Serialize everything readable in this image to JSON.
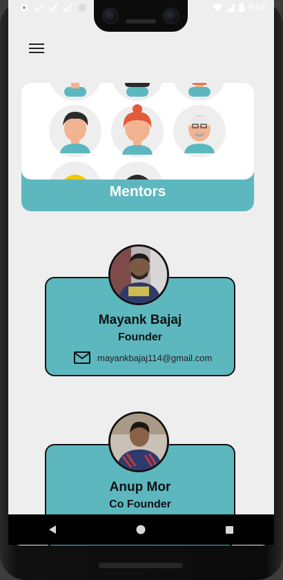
{
  "status_bar": {
    "time": "9:54",
    "left_icons": [
      "settings-icon",
      "check-icon",
      "check-icon",
      "check-icon",
      "circle-icon"
    ],
    "right_icons": [
      "wifi-icon",
      "signal-icon",
      "battery-icon"
    ]
  },
  "header": {
    "menu_icon": "hamburger-menu-icon"
  },
  "banner": {
    "title": "Mentors"
  },
  "mentors": [
    {
      "name": "Mayank Bajaj",
      "role": "Founder",
      "email": "mayankbajaj114@gmail.com"
    },
    {
      "name": "Anup Mor",
      "role": "Co Founder"
    }
  ],
  "nav": {
    "icons": [
      "back-icon",
      "home-icon",
      "recents-icon"
    ]
  },
  "colors": {
    "accent": "#5db7bf",
    "background": "#eeeeee",
    "text": "#111111"
  }
}
